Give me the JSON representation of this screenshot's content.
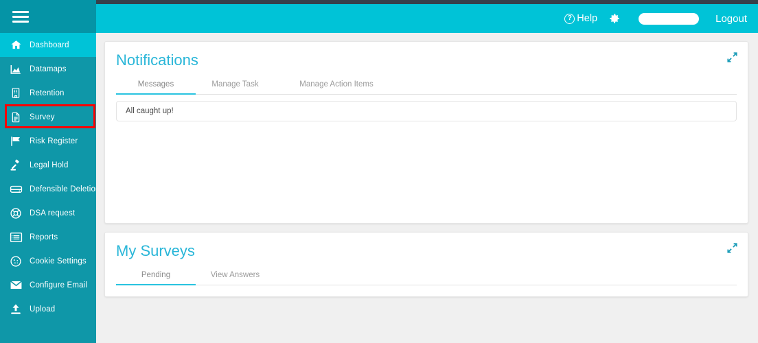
{
  "header": {
    "help_label": "Help",
    "help_icon": "question-circle-icon",
    "gear_icon": "gear-icon",
    "user_name": "",
    "logout_label": "Logout"
  },
  "sidebar": {
    "menu_icon": "hamburger-icon",
    "items": [
      {
        "label": "Dashboard",
        "icon": "home-icon",
        "active": true
      },
      {
        "label": "Datamaps",
        "icon": "chart-area-icon",
        "active": false
      },
      {
        "label": "Retention",
        "icon": "building-icon",
        "active": false
      },
      {
        "label": "Survey",
        "icon": "document-icon",
        "active": false
      },
      {
        "label": "Risk Register",
        "icon": "flag-icon",
        "active": false
      },
      {
        "label": "Legal Hold",
        "icon": "gavel-icon",
        "active": false
      },
      {
        "label": "Defensible Deletion",
        "icon": "hard-drive-icon",
        "active": false
      },
      {
        "label": "DSA request",
        "icon": "lifebuoy-icon",
        "active": false
      },
      {
        "label": "Reports",
        "icon": "list-icon",
        "active": false
      },
      {
        "label": "Cookie Settings",
        "icon": "cookie-icon",
        "active": false
      },
      {
        "label": "Configure Email",
        "icon": "envelope-icon",
        "active": false
      },
      {
        "label": "Upload",
        "icon": "upload-icon",
        "active": false
      }
    ],
    "highlight": {
      "target": "Survey",
      "color": "#ff0000"
    }
  },
  "notifications": {
    "title": "Notifications",
    "expand_icon": "expand-arrows-icon",
    "tabs": [
      {
        "label": "Messages",
        "active": true
      },
      {
        "label": "Manage Task",
        "active": false
      },
      {
        "label": "Manage Action Items",
        "active": false
      }
    ],
    "empty_message": "All caught up!"
  },
  "surveys": {
    "title": "My Surveys",
    "expand_icon": "expand-arrows-icon",
    "tabs": [
      {
        "label": "Pending",
        "active": true
      },
      {
        "label": "View Answers",
        "active": false
      }
    ]
  },
  "colors": {
    "accent": "#00c3d7",
    "sidebar": "#0f97a8",
    "sidebar_top": "#0594a6",
    "title": "#29b6d8",
    "topbar_dark": "#36404a",
    "highlight": "#ff0000",
    "page_bg": "#f0f0f0"
  }
}
